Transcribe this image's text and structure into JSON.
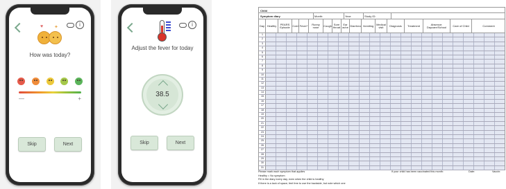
{
  "screen1": {
    "question": "How was today?",
    "minus": "—",
    "plus": "+",
    "skip_label": "Skip",
    "next_label": "Next",
    "info_symbol": "i",
    "face_colors": [
      "#e55a4a",
      "#f08c3a",
      "#ecc83a",
      "#a5c84a",
      "#5ab45a"
    ]
  },
  "screen2": {
    "instruction": "Adjust the fever for today",
    "temperature": "38.5",
    "skip_label": "Skip",
    "next_label": "Next",
    "info_symbol": "i"
  },
  "sheet": {
    "child_label": "Child",
    "diary_label": "Symptom diary",
    "month_label": "Month:",
    "year_label": "Year:",
    "study_id_label": "Study ID:",
    "columns": [
      "Day",
      "Healthy",
      "PEARS Episode",
      "Cold",
      "Fever*",
      "Runny nose",
      "Cough",
      "Sore throat",
      "Ear ache",
      "Diarrhea",
      "Vomiting",
      "Medical visit",
      "Diagnosis",
      "Treatment",
      "Absence: Daycare/School",
      "Care of Child",
      "Comment"
    ],
    "days": [
      "1",
      "2",
      "3",
      "4",
      "5",
      "6",
      "7",
      "8",
      "9",
      "10",
      "11",
      "12",
      "13",
      "14",
      "15",
      "16",
      "17",
      "18",
      "19",
      "20",
      "21",
      "22",
      "23",
      "24",
      "25",
      "26",
      "27",
      "28",
      "29",
      "30",
      "31"
    ],
    "footer_line1": "Please mark each symptom that applies",
    "footer_line2": "Healthy = No symptom",
    "footer_line3": "Fill in the diary every day, even when the child is healthy",
    "footer_line4": "If there is a lack of space, feel free to use the backside, but note which one",
    "vaccinated_note": "If your child has been vaccinated this month:",
    "date_label": "Date:",
    "vaccine_label": "Vaccin:"
  }
}
